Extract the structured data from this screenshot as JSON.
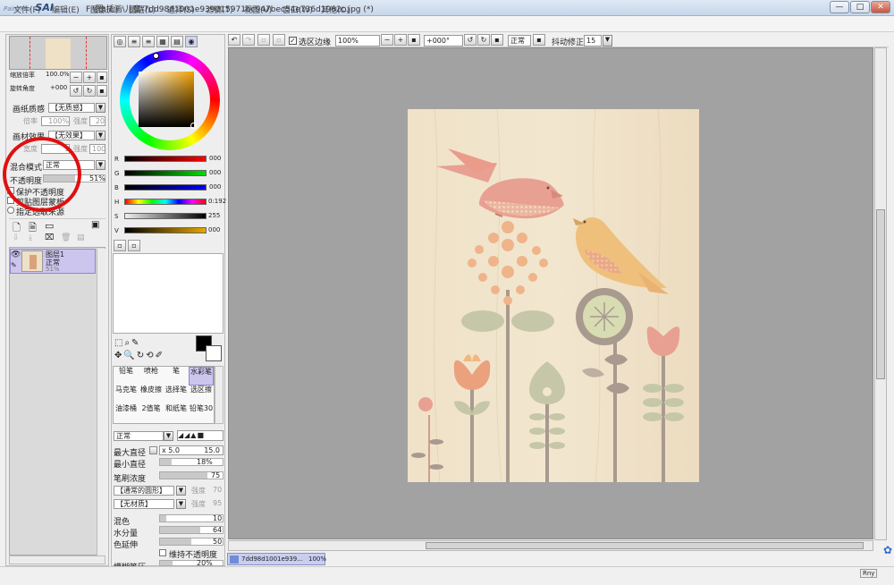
{
  "app": {
    "logo": "SAI",
    "logo_small": "PaintTool",
    "title": "F:\\图\\插画\\儿童\\7dd98d1001e939015971bc947bec54e736d1962c.jpg (*)"
  },
  "menu": [
    "文件(F)",
    "编辑(E)",
    "图像(C)",
    "图层(L)",
    "选择(S)",
    "滤镜(T)",
    "视图(V)",
    "窗口(W)",
    "其他(O)"
  ],
  "navigator": {
    "zoom_label": "缩放倍率",
    "zoom_value": "100.0%",
    "angle_label": "旋转角度",
    "angle_value": "+000"
  },
  "texture": {
    "paper_label": "画纸质感",
    "paper_value": "【无质感】",
    "scale_label": "倍率",
    "scale_value": "100%",
    "strength_label": "强度",
    "strength_value": "20",
    "effect_label": "画材效果",
    "effect_value": "【无效果】",
    "width_label": "宽度",
    "width_value": "1",
    "str2_label": "强度",
    "str2_value": "100"
  },
  "layer_props": {
    "blend_label": "混合模式",
    "blend_value": "正常",
    "opacity_label": "不透明度",
    "opacity_value": "51%",
    "opacity_frac": 0.51,
    "protect_label": "保护不透明度",
    "clip_label": "剪贴图层蒙板",
    "sel_label": "指定选取来源"
  },
  "layers": [
    {
      "name": "图层1",
      "mode": "正常",
      "opacity": "51%"
    }
  ],
  "color": {
    "r": "000",
    "g": "000",
    "b": "000",
    "h": "0:192",
    "s": "255",
    "v": "000",
    "rl": "R",
    "gl": "G",
    "bl": "B",
    "hl": "H",
    "sl": "S",
    "vl": "V"
  },
  "tools": [
    "铅笔",
    "喷枪",
    "笔",
    "水彩笔",
    "马克笔",
    "橡皮擦",
    "选择笔",
    "选区擦",
    "油漆桶",
    "2值笔",
    "和纸笔",
    "铅笔30"
  ],
  "brush": {
    "mode": "正常",
    "max_label": "最大直径",
    "max_mult": "x 5.0",
    "max_value": "15.0",
    "min_label": "最小直径",
    "min_value": "18%",
    "min_frac": 0.18,
    "density_label": "笔刷浓度",
    "density_value": "75",
    "density_frac": 0.75,
    "shape_value": "【通常的圆形】",
    "shape_str_label": "强度",
    "shape_str_value": "70",
    "tex_value": "【无材质】",
    "tex_str_label": "强度",
    "tex_str_value": "95",
    "blend_label": "混色",
    "blend_value": "10",
    "blend_frac": 0.1,
    "water_label": "水分量",
    "water_value": "64",
    "water_frac": 0.64,
    "stretch_label": "色延伸",
    "stretch_value": "50",
    "stretch_frac": 0.5,
    "keep_label": "维持不透明度",
    "blur_label": "模糊笔压",
    "blur_value": "20%",
    "blur_frac": 0.2
  },
  "toolbar": {
    "sel_edge": "选区边缘",
    "zoom": "100%",
    "angle": "+000°",
    "mode": "正常",
    "stab_label": "抖动修正",
    "stab_value": "15"
  },
  "doc_tab": {
    "name": "7dd98d1001e939...",
    "zoom": "100%"
  },
  "status": {
    "ime": "Rny"
  },
  "colors": {
    "title_bg": "#c7d6ea",
    "canvas_bg": "#a2a2a2",
    "paper": "#efe1c6",
    "bird1": "#e8a092",
    "bird2": "#efc07c",
    "leaf": "#c6c7a8",
    "stem": "#a89a8e",
    "annotation": "#e01010"
  }
}
